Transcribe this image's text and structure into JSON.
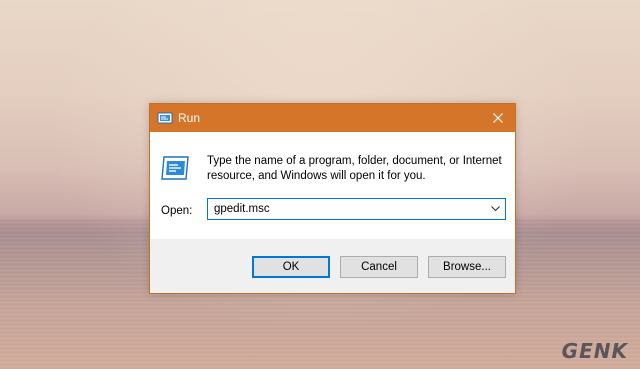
{
  "window": {
    "title": "Run",
    "title_icon": "run-app-icon",
    "close_icon": "close-icon"
  },
  "dialog": {
    "icon": "run-program-icon",
    "description": "Type the name of a program, folder, document, or Internet resource, and Windows will open it for you.",
    "open_label": "Open:",
    "open_value": "gpedit.msc",
    "dropdown_icon": "chevron-down-icon"
  },
  "buttons": {
    "ok": "OK",
    "cancel": "Cancel",
    "browse": "Browse..."
  },
  "watermark": {
    "text": "GENK"
  },
  "colors": {
    "titlebar": "#d5752a",
    "accent": "#0078d7",
    "footer": "#f0f0f0"
  }
}
